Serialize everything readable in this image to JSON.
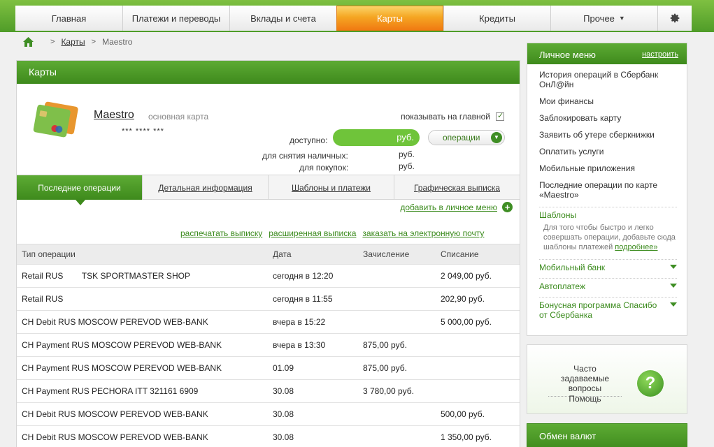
{
  "nav": {
    "tabs": [
      {
        "label": "Главная"
      },
      {
        "label": "Платежи и переводы"
      },
      {
        "label": "Вклады и счета"
      },
      {
        "label": "Карты"
      },
      {
        "label": "Кредиты"
      },
      {
        "label": "Прочее"
      }
    ],
    "active_tab": "Карты",
    "settings_icon": "gear-icon"
  },
  "breadcrumb": {
    "home_icon": "home-icon",
    "items": [
      "Карты",
      "Maestro"
    ]
  },
  "main": {
    "title": "Карты",
    "card": {
      "name": "Maestro",
      "type": "основная карта",
      "number": "*** **** ***",
      "show_on_main_label": "показывать на главной",
      "show_on_main_checked": true,
      "available_label": "доступно:",
      "available_value": "руб.",
      "operations_button": "операции",
      "cash_label": "для снятия наличных:",
      "cash_value": "руб.",
      "purchases_label": "для покупок:",
      "purchases_value": "руб."
    },
    "tabs": [
      {
        "label": "Последние операции"
      },
      {
        "label": "Детальная информация"
      },
      {
        "label": "Шаблоны и платежи"
      },
      {
        "label": "Графическая выписка"
      }
    ],
    "add_to_menu_link": "добавить в личное меню",
    "statement_links": [
      "распечатать выписку",
      "расширенная выписка",
      "заказать на электронную почту"
    ],
    "table": {
      "headers": [
        "Тип операции",
        "Дата",
        "Зачисление",
        "Списание"
      ],
      "rows": [
        [
          "Retail RUS        TSK SPORTMASTER SHOP",
          "сегодня в 12:20",
          "",
          "2 049,00 руб."
        ],
        [
          "Retail RUS",
          "сегодня в 11:55",
          "",
          "202,90 руб."
        ],
        [
          "CH Debit RUS MOSCOW PEREVOD WEB-BANK",
          "вчера в 15:22",
          "",
          "5 000,00 руб."
        ],
        [
          "CH Payment RUS MOSCOW PEREVOD WEB-BANK",
          "вчера в 13:30",
          "875,00 руб.",
          ""
        ],
        [
          "CH Payment RUS MOSCOW PEREVOD WEB-BANK",
          "01.09",
          "875,00 руб.",
          ""
        ],
        [
          "CH Payment RUS PECHORA ITT 321161 6909",
          "30.08",
          "3 780,00 руб.",
          ""
        ],
        [
          "CH Debit RUS MOSCOW PEREVOD WEB-BANK",
          "30.08",
          "",
          "500,00 руб."
        ],
        [
          "CH Debit RUS MOSCOW PEREVOD WEB-BANK",
          "30.08",
          "",
          "1 350,00 руб."
        ]
      ]
    }
  },
  "side": {
    "title": "Личное меню",
    "configure_link": "настроить",
    "items": [
      "История операций в Сбербанк ОнЛ@йн",
      "Мои финансы",
      "Заблокировать карту",
      "Заявить об утере сберкнижки",
      "Оплатить услуги",
      "Мобильные приложения",
      "Последние операции по карте «Maestro»"
    ],
    "templates_title": "Шаблоны",
    "templates_note": "Для того чтобы быстро и легко совершать операции, добавьте сюда шаблоны платежей",
    "templates_more": "подробнее»",
    "expanders": [
      "Мобильный банк",
      "Автоплатеж",
      "Бонусная программа Спасибо от Сбербанка"
    ]
  },
  "faq": {
    "title": "Часто задаваемые вопросы",
    "help": "Помощь"
  },
  "exchange": {
    "title": "Обмен валют"
  },
  "colors": {
    "brand_green": "#3e8a1c",
    "accent_orange": "#f5a623",
    "link_green": "#3a8a1c"
  }
}
